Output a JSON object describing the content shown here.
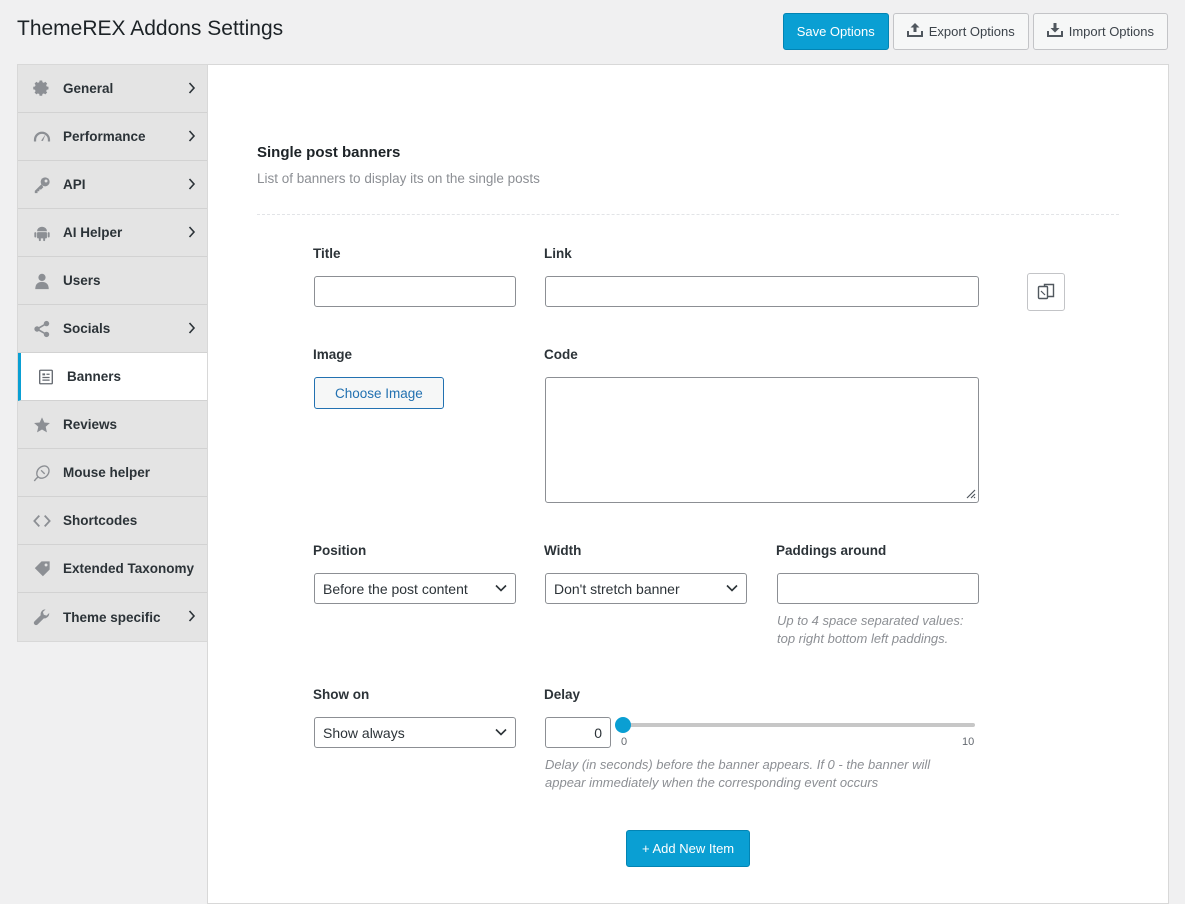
{
  "header": {
    "title": "ThemeREX Addons Settings",
    "save_label": "Save Options",
    "export_label": "Export Options",
    "import_label": "Import Options"
  },
  "sidebar": {
    "items": [
      {
        "label": "General",
        "icon": "gear-icon",
        "has_submenu": true
      },
      {
        "label": "Performance",
        "icon": "gauge-icon",
        "has_submenu": true
      },
      {
        "label": "API",
        "icon": "key-icon",
        "has_submenu": true
      },
      {
        "label": "AI Helper",
        "icon": "android-icon",
        "has_submenu": true
      },
      {
        "label": "Users",
        "icon": "user-icon",
        "has_submenu": false
      },
      {
        "label": "Socials",
        "icon": "share-icon",
        "has_submenu": true
      },
      {
        "label": "Banners",
        "icon": "banner-icon",
        "has_submenu": false,
        "active": true
      },
      {
        "label": "Reviews",
        "icon": "star-icon",
        "has_submenu": false
      },
      {
        "label": "Mouse helper",
        "icon": "mouse-icon",
        "has_submenu": false
      },
      {
        "label": "Shortcodes",
        "icon": "code-icon",
        "has_submenu": false
      },
      {
        "label": "Extended Taxonomy",
        "icon": "tag-icon",
        "has_submenu": false
      },
      {
        "label": "Theme specific",
        "icon": "wrench-icon",
        "has_submenu": true
      }
    ]
  },
  "main": {
    "section_title": "Single post banners",
    "section_desc": "List of banners to display its on the single posts",
    "fields": {
      "title_label": "Title",
      "title_value": "",
      "link_label": "Link",
      "link_value": "",
      "image_label": "Image",
      "choose_image_label": "Choose Image",
      "code_label": "Code",
      "code_value": "",
      "position_label": "Position",
      "position_value": "Before the post content",
      "width_label": "Width",
      "width_value": "Don't stretch banner",
      "paddings_label": "Paddings around",
      "paddings_value": "",
      "paddings_hint_line1": "Up to 4 space separated values:",
      "paddings_hint_line2": "top right bottom left paddings.",
      "show_on_label": "Show on",
      "show_on_value": "Show always",
      "delay_label": "Delay",
      "delay_value": "0",
      "delay_min": "0",
      "delay_max": "10",
      "delay_hint_line1": "Delay (in seconds) before the banner appears. If 0 - the banner will",
      "delay_hint_line2": "appear immediately when the corresponding event occurs"
    },
    "add_item_label": "+ Add New Item"
  },
  "colors": {
    "accent": "#0a9fd3",
    "sidebar_bg": "#e4e4e4",
    "page_bg": "#f0f0f1"
  }
}
